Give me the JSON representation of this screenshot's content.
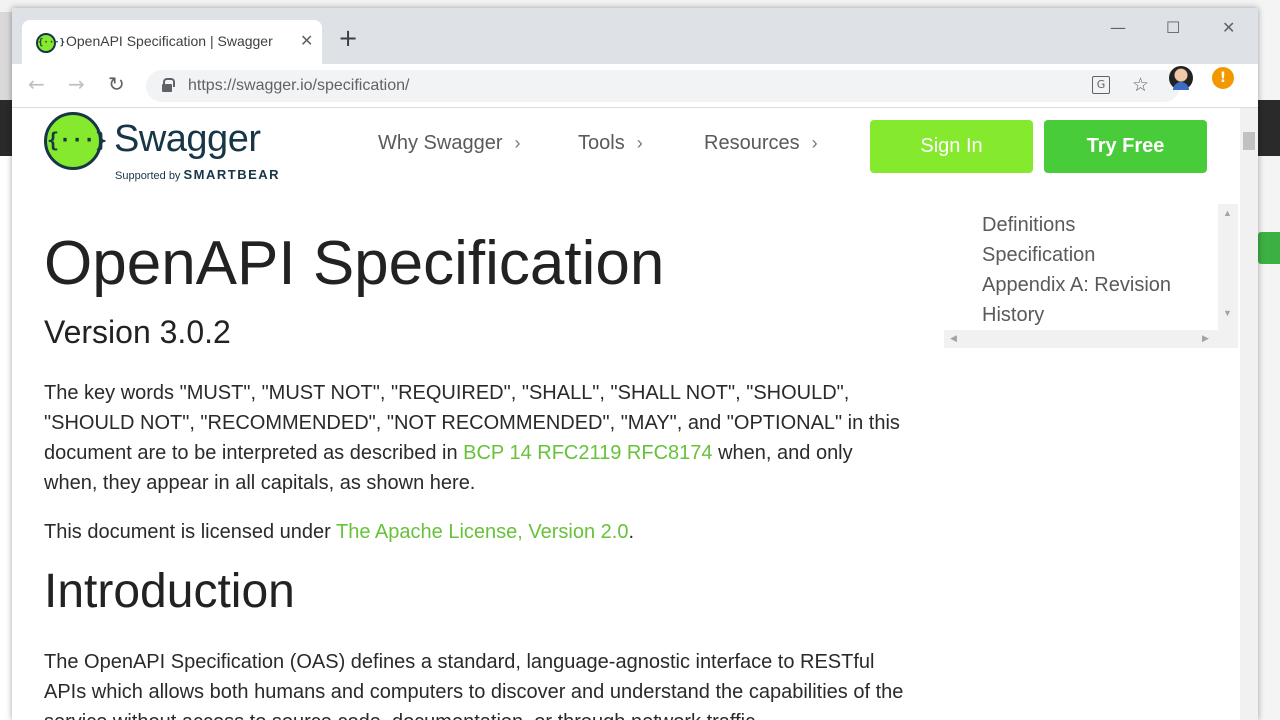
{
  "browser": {
    "tab_title": "OpenAPI Specification | Swagger",
    "tab_close": "✕",
    "new_tab": "+",
    "url": "https://swagger.io/specification/",
    "back": "←",
    "forward": "→",
    "reload": "↻",
    "translate": "G",
    "star": "☆",
    "alert": "!",
    "minimize": "—",
    "maximize": "☐",
    "close": "✕"
  },
  "header": {
    "logo_mark": "{···}",
    "logo_text": "Swagger",
    "logo_supported": "Supported by",
    "logo_brand": "SMARTBEAR",
    "nav": [
      {
        "label": "Why Swagger",
        "chevron": "›"
      },
      {
        "label": "Tools",
        "chevron": "›"
      },
      {
        "label": "Resources",
        "chevron": "›"
      }
    ],
    "signin": "Sign In",
    "try_free": "Try Free"
  },
  "toc": {
    "items": [
      "Definitions",
      "Specification",
      "Appendix A: Revision",
      "History"
    ],
    "arrows": {
      "up": "▲",
      "down": "▼",
      "left": "◀",
      "right": "▶"
    }
  },
  "main": {
    "title": "OpenAPI Specification",
    "version": "Version 3.0.2",
    "p1_before": "The key words \"MUST\", \"MUST NOT\", \"REQUIRED\", \"SHALL\", \"SHALL NOT\", \"SHOULD\", \"SHOULD NOT\", \"RECOMMENDED\", \"NOT RECOMMENDED\", \"MAY\", and \"OPTIONAL\" in this document are to be interpreted as described in ",
    "p1_link": "BCP 14 RFC2119 RFC8174",
    "p1_after": " when, and only when, they appear in all capitals, as shown here.",
    "p2_before": "This document is licensed under ",
    "p2_link": "The Apache License, Version 2.0",
    "p2_after": ".",
    "h2": "Introduction",
    "p3": "The OpenAPI Specification (OAS) defines a standard, language-agnostic interface to RESTful APIs which allows both humans and computers to discover and understand the capabilities of the service without access to source code, documentation, or through network traffic"
  },
  "colors": {
    "brand_green": "#85ea2d",
    "try_green": "#49cc39",
    "link_green": "#67c23a",
    "brand_dark": "#173647"
  }
}
